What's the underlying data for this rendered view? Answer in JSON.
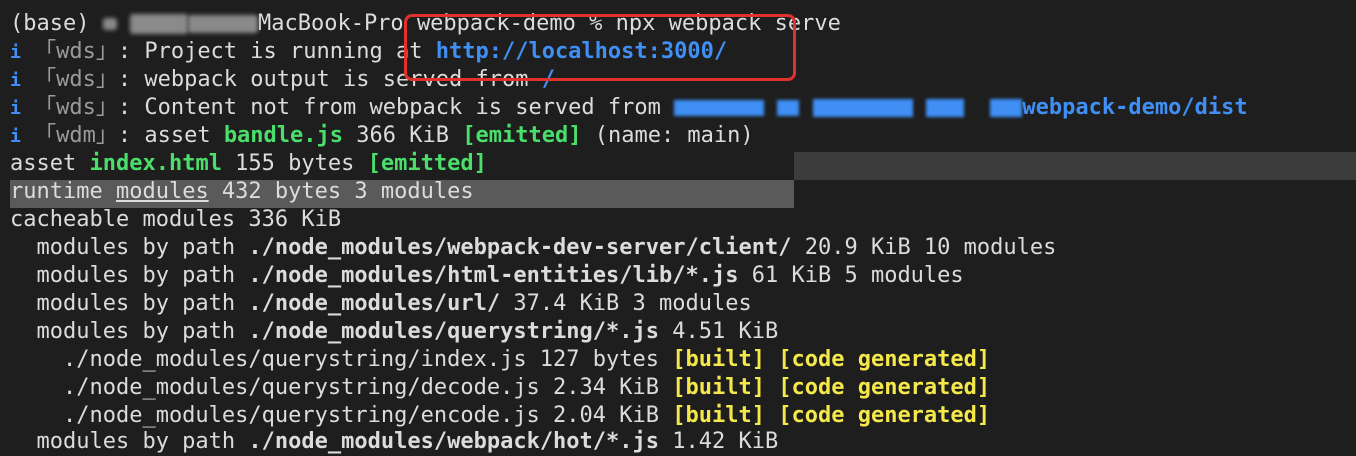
{
  "prompt": {
    "env": "(base)",
    "host_tail": "MacBook-Pro",
    "dir": "webpack-demo",
    "symbol": "%",
    "command": "npx webpack serve"
  },
  "info_icon": "i",
  "wds_lines": [
    {
      "tag": "「wds」",
      "text": ": Project is running at ",
      "link": "http://localhost:3000/"
    },
    {
      "tag": "「wds」",
      "text": ": webpack output is served from ",
      "link": "/"
    },
    {
      "tag": "「wds」",
      "text": ": Content not from webpack is served from ",
      "link": "webpack-demo/dist"
    }
  ],
  "wdm_line": {
    "tag": "「wdm」",
    "prefix": ": asset ",
    "file": "bandle.js",
    "size": " 366 KiB ",
    "status": "[emitted]",
    "suffix": " (name: main)"
  },
  "asset_line": {
    "prefix": "asset ",
    "file": "index.html",
    "size": " 155 bytes ",
    "status": "[emitted]"
  },
  "runtime_line": {
    "prefix": "runtime ",
    "word": "modules",
    "suffix": " 432 bytes 3 modules"
  },
  "cacheable_line": "cacheable modules 336 KiB",
  "module_paths": [
    {
      "prefix": "  modules by path ",
      "path": "./node_modules/webpack-dev-server/client/",
      "info": " 20.9 KiB 10 modules"
    },
    {
      "prefix": "  modules by path ",
      "path": "./node_modules/html-entities/lib/*.js",
      "info": " 61 KiB 5 modules"
    },
    {
      "prefix": "  modules by path ",
      "path": "./node_modules/url/",
      "info": " 37.4 KiB 3 modules"
    },
    {
      "prefix": "  modules by path ",
      "path": "./node_modules/querystring/*.js",
      "info": " 4.51 KiB"
    }
  ],
  "built_files": [
    {
      "path": "    ./node_modules/querystring/index.js",
      "size": " 127 bytes ",
      "built": "[built]",
      "gen": "[code generated]"
    },
    {
      "path": "    ./node_modules/querystring/decode.js",
      "size": " 2.34 KiB ",
      "built": "[built]",
      "gen": "[code generated]"
    },
    {
      "path": "    ./node_modules/querystring/encode.js",
      "size": " 2.04 KiB ",
      "built": "[built]",
      "gen": "[code generated]"
    }
  ],
  "last_line": {
    "prefix": "  modules by path ",
    "path": "./node_modules/webpack/hot/*.js",
    "info": " 1.42 KiB"
  }
}
